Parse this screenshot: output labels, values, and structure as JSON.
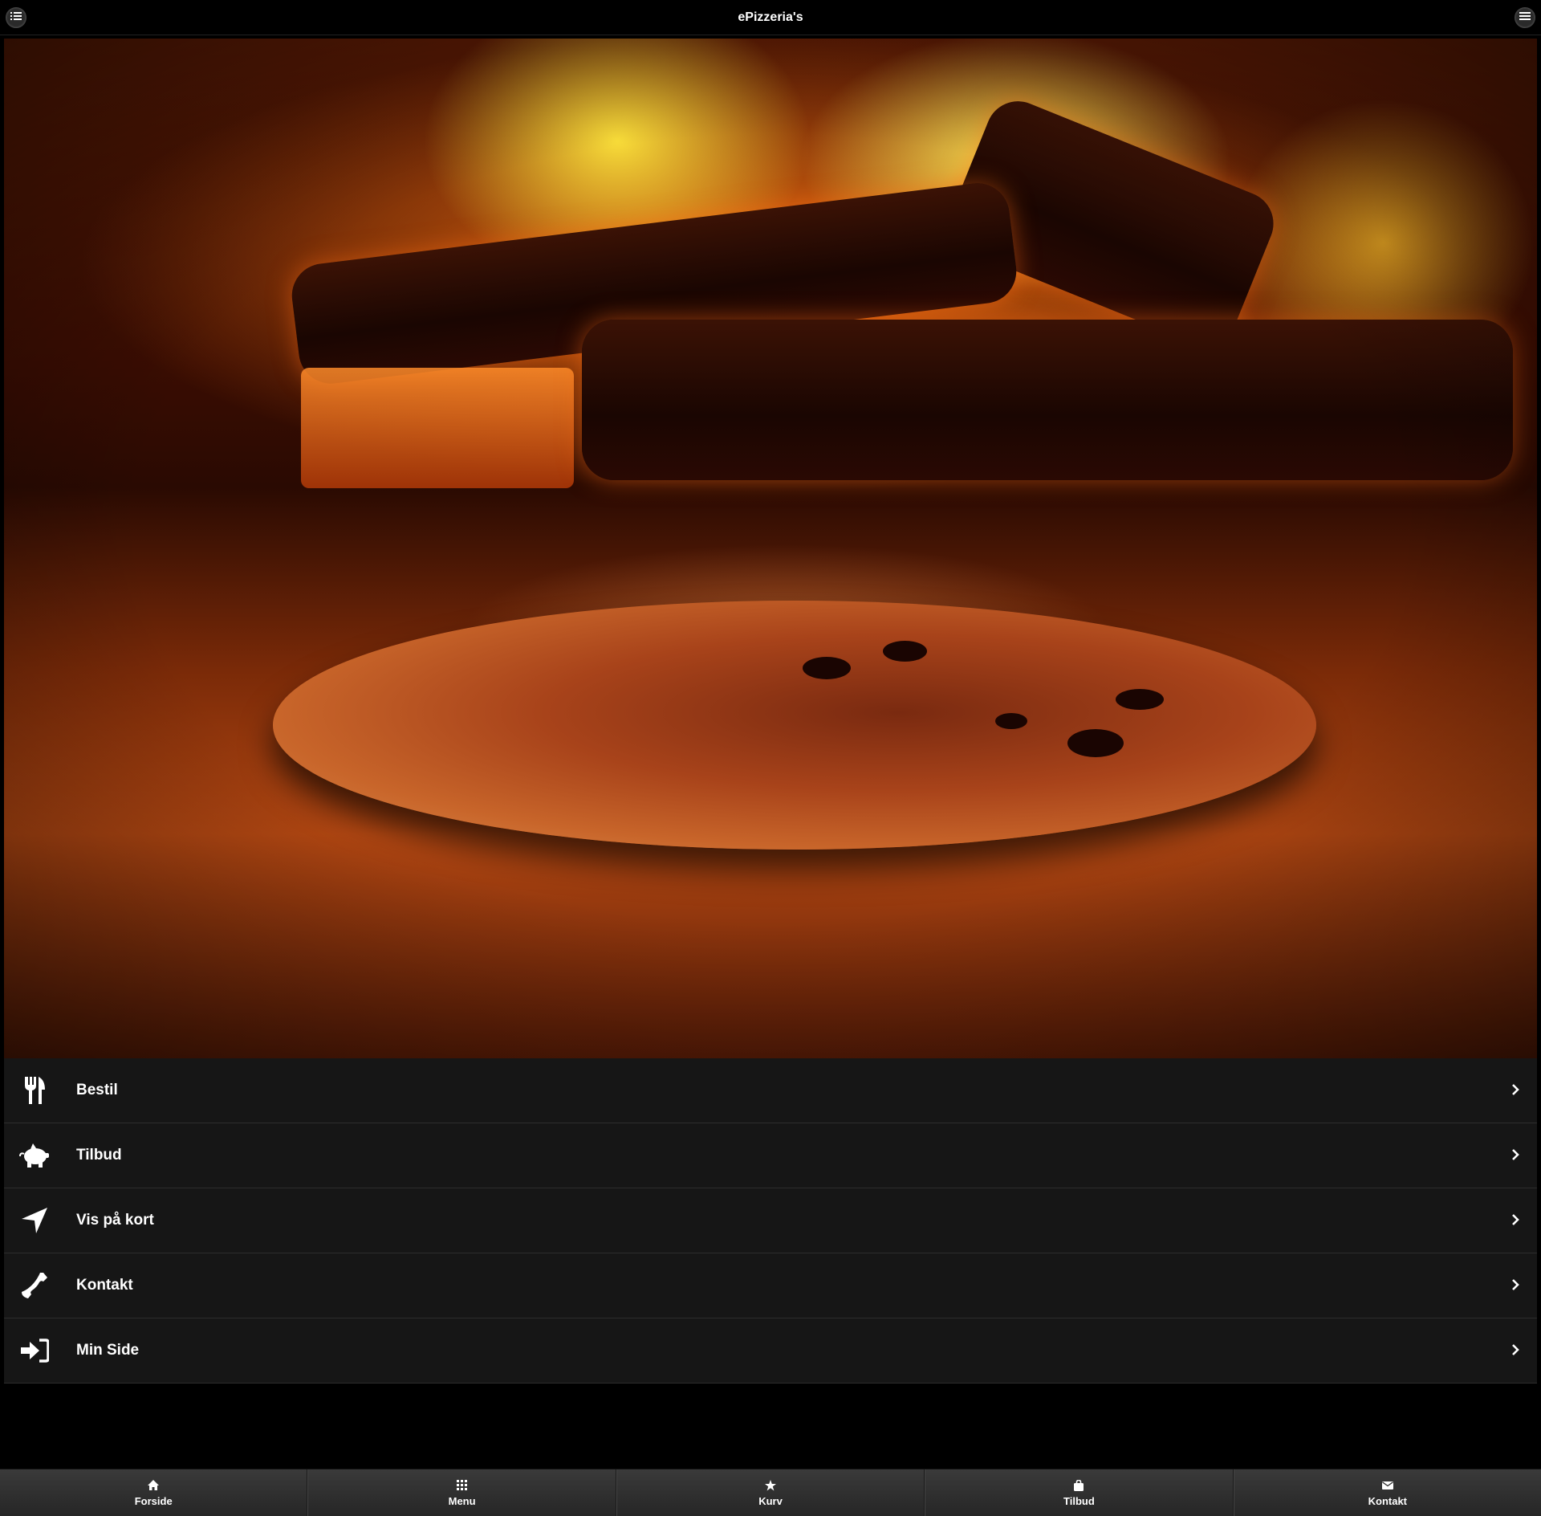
{
  "header": {
    "title": "ePizzeria's",
    "left_button_icon": "list-icon",
    "right_button_icon": "hamburger-menu-icon"
  },
  "hero": {
    "image": "pizza-in-wood-fired-oven"
  },
  "menu_items": [
    {
      "label": "Bestil",
      "icon": "fork-knife-icon"
    },
    {
      "label": "Tilbud",
      "icon": "piggy-bank-icon"
    },
    {
      "label": "Vis på kort",
      "icon": "location-arrow-icon"
    },
    {
      "label": "Kontakt",
      "icon": "phone-icon"
    },
    {
      "label": "Min Side",
      "icon": "sign-in-icon"
    }
  ],
  "footer_nav": [
    {
      "label": "Forside",
      "icon": "home-icon"
    },
    {
      "label": "Menu",
      "icon": "grid-icon"
    },
    {
      "label": "Kurv",
      "icon": "star-icon"
    },
    {
      "label": "Tilbud",
      "icon": "shopping-bag-icon"
    },
    {
      "label": "Kontakt",
      "icon": "envelope-icon"
    }
  ],
  "colors": {
    "background": "#000000",
    "list_item": "#161616",
    "footer": "#2f2f2f",
    "text": "#ffffff"
  }
}
